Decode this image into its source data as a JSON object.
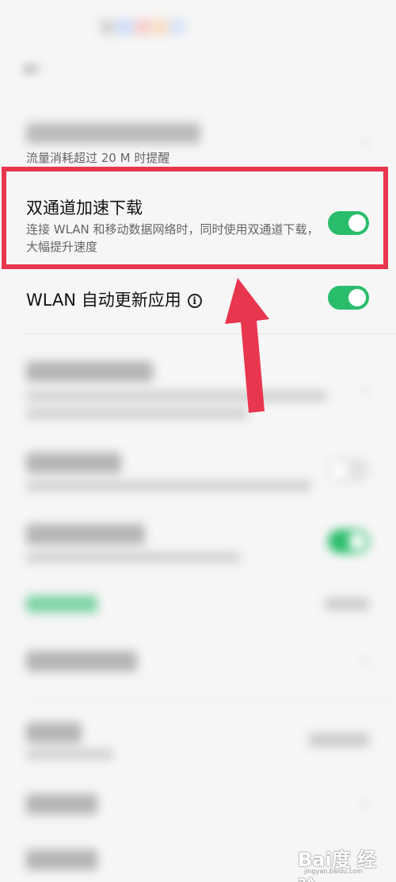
{
  "status_bar": {
    "time": "",
    "indicators": ""
  },
  "header": {
    "back_icon": "back-arrow-icon",
    "title": ""
  },
  "rows": {
    "mobile_network": {
      "title": "",
      "subtitle": "流量消耗超过 20 M 时提醒"
    },
    "dual_channel": {
      "title": "双通道加速下载",
      "subtitle": "连接 WLAN 和移动数据网络时，同时使用双通道下载，大幅提升速度",
      "enabled": true
    },
    "wlan_auto_update": {
      "title": "WLAN 自动更新应用",
      "enabled": true
    },
    "blurred_toggle_1": {
      "enabled": false
    },
    "blurred_toggle_2": {
      "enabled": true
    }
  },
  "colors": {
    "toggle_on": "#29bd6b",
    "highlight_border": "#e8364f",
    "arrow": "#e8364f"
  },
  "watermark": {
    "logo": "Bai度 经验",
    "url": "jingyan.baidu.com"
  }
}
